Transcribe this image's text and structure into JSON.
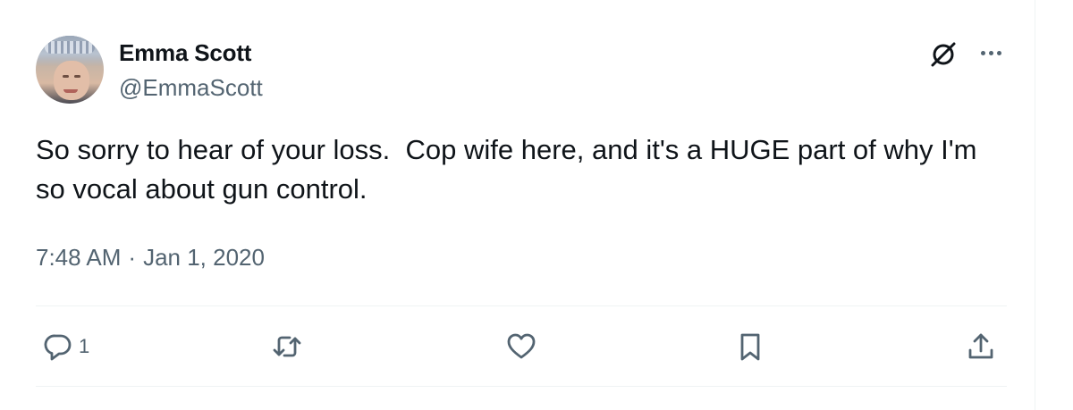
{
  "author": {
    "name": "Emma Scott",
    "handle": "@EmmaScott"
  },
  "tweet": {
    "text": "So sorry to hear of your loss.  Cop wife here, and it's a HUGE part of why I'm so vocal about gun control.",
    "time": "7:48 AM",
    "separator": "·",
    "date": "Jan 1, 2020"
  },
  "actions": {
    "reply_count": "1"
  },
  "icons": {
    "grok": "grok-icon",
    "more": "more-options-icon",
    "reply": "reply-icon",
    "retweet": "retweet-icon",
    "like": "heart-icon",
    "bookmark": "bookmark-icon",
    "share": "share-icon"
  },
  "colors": {
    "text_primary": "#0f1419",
    "text_secondary": "#536471",
    "divider": "#eff3f4"
  }
}
